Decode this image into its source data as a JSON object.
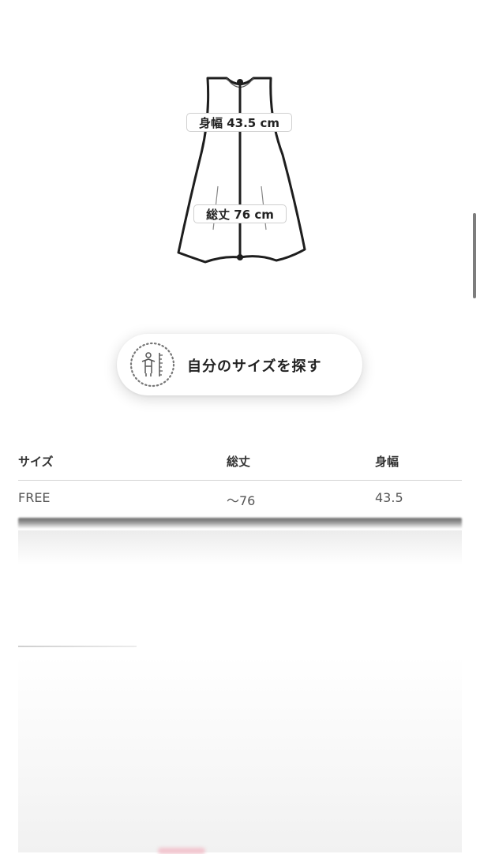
{
  "diagram": {
    "width_label": "身幅 43.5 cm",
    "length_label": "総丈 76 cm"
  },
  "find_size_button": {
    "label": "自分のサイズを探す",
    "icon": "body-measure-icon"
  },
  "size_table": {
    "headers": [
      "サイズ",
      "総丈",
      "身幅"
    ],
    "rows": [
      [
        "FREE",
        "〜76",
        "43.5"
      ]
    ]
  }
}
